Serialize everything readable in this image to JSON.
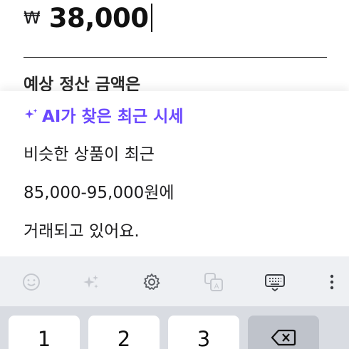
{
  "price": {
    "currency_symbol": "₩",
    "amount": "38,000"
  },
  "estimate_label": "예상 정산 금액은",
  "ai_card": {
    "title": "AI가 찾은 최근 시세",
    "lines": [
      "비슷한 상품이 최근",
      "85,000-95,000원에",
      "거래되고 있어요."
    ]
  },
  "keyboard": {
    "toolbar": [
      "emoji-icon",
      "sparkles-icon",
      "gear-icon",
      "translate-icon",
      "keyboard-icon",
      "more-icon"
    ],
    "keys": [
      "1",
      "2",
      "3"
    ],
    "accent_color": "#6b48ff"
  }
}
